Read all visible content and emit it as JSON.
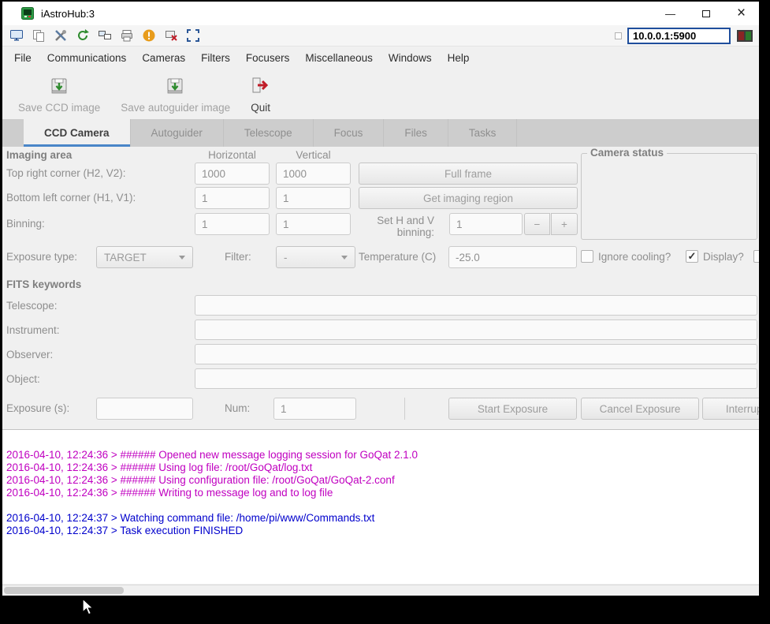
{
  "theme": {
    "tab_underline": "#4a86c8",
    "log_magenta": "#c000c0",
    "log_blue": "#0000cc",
    "warning_orange": "#e89c1c",
    "quit_red": "#c01c28",
    "refresh_green": "#2e8b2e",
    "address_border_blue": "#1f4e9c"
  },
  "titlebar": {
    "title": "iAstroHub:3",
    "minimize_glyph": "—",
    "close_glyph": "×"
  },
  "vnc": {
    "address": "10.0.0.1:5900",
    "icons": [
      "new-connection",
      "copy",
      "options",
      "refresh",
      "listen",
      "print",
      "warning",
      "disconnect",
      "fullscreen"
    ]
  },
  "menu": {
    "items": [
      "File",
      "Communications",
      "Cameras",
      "Filters",
      "Focusers",
      "Miscellaneous",
      "Windows",
      "Help"
    ]
  },
  "app_toolbar": {
    "save_ccd_label": "Save CCD image",
    "save_autoguider_label": "Save autoguider image",
    "quit_label": "Quit"
  },
  "tabs": {
    "items": [
      {
        "label": "CCD Camera",
        "active": true
      },
      {
        "label": "Autoguider",
        "active": false
      },
      {
        "label": "Telescope",
        "active": false
      },
      {
        "label": "Focus",
        "active": false
      },
      {
        "label": "Files",
        "active": false
      },
      {
        "label": "Tasks",
        "active": false
      }
    ]
  },
  "imaging": {
    "title": "Imaging area",
    "col_horizontal": "Horizontal",
    "col_vertical": "Vertical",
    "camera_status_title": "Camera status",
    "top_right": {
      "label": "Top right corner (H2, V2):",
      "h": "1000",
      "v": "1000",
      "button": "Full frame"
    },
    "bottom_left": {
      "label": "Bottom left corner (H1, V1):",
      "h": "1",
      "v": "1",
      "button": "Get imaging region"
    },
    "binning": {
      "label": "Binning:",
      "h": "1",
      "v": "1",
      "set_label": "Set H and V binning:",
      "value": "1",
      "decrement": "−",
      "increment": "+"
    }
  },
  "exposure_settings": {
    "type_label": "Exposure type:",
    "type_value": "TARGET",
    "filter_label": "Filter:",
    "filter_value": "-",
    "temperature_label": "Temperature (C)",
    "temperature_value": "-25.0",
    "ignore_cooling_label": "Ignore cooling?",
    "ignore_cooling_checked": false,
    "display_label": "Display?",
    "display_checked": true
  },
  "fits": {
    "title": "FITS keywords",
    "fields": [
      {
        "label": "Telescope:",
        "value": ""
      },
      {
        "label": "Instrument:",
        "value": ""
      },
      {
        "label": "Observer:",
        "value": ""
      },
      {
        "label": "Object:",
        "value": ""
      }
    ]
  },
  "exposure_controls": {
    "exposure_label": "Exposure (s):",
    "exposure_value": "",
    "num_label": "Num:",
    "num_value": "1",
    "start_button": "Start Exposure",
    "cancel_button": "Cancel Exposure",
    "interrupt_button": "Interrupt"
  },
  "log": {
    "lines": [
      {
        "text": "2016-04-10, 12:24:36 > ###### Opened new message logging session for GoQat 2.1.0",
        "color": "#c000c0"
      },
      {
        "text": "2016-04-10, 12:24:36 > ###### Using log file: /root/GoQat/log.txt",
        "color": "#c000c0"
      },
      {
        "text": "2016-04-10, 12:24:36 > ###### Using configuration file: /root/GoQat/GoQat-2.conf",
        "color": "#c000c0"
      },
      {
        "text": "2016-04-10, 12:24:36 > ###### Writing to message log and to log file",
        "color": "#c000c0"
      },
      {
        "text": "",
        "color": ""
      },
      {
        "text": "2016-04-10, 12:24:37 > Watching command file: /home/pi/www/Commands.txt",
        "color": "#0000cc"
      },
      {
        "text": "2016-04-10, 12:24:37 > Task execution FINISHED",
        "color": "#0000cc"
      }
    ]
  },
  "ui": {
    "checkmark": "✓"
  }
}
